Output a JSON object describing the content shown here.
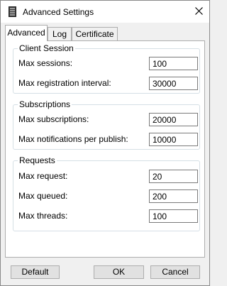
{
  "window": {
    "title": "Advanced Settings"
  },
  "tabs": [
    {
      "label": "Advanced",
      "active": true
    },
    {
      "label": "Log",
      "active": false
    },
    {
      "label": "Certificate",
      "active": false
    }
  ],
  "groups": {
    "client_session": {
      "title": "Client Session",
      "max_sessions": {
        "label": "Max sessions:",
        "value": "100"
      },
      "max_registration_interval": {
        "label": "Max registration interval:",
        "value": "30000"
      }
    },
    "subscriptions": {
      "title": "Subscriptions",
      "max_subscriptions": {
        "label": "Max subscriptions:",
        "value": "20000"
      },
      "max_notifications_per_publish": {
        "label": "Max notifications per publish:",
        "value": "10000"
      }
    },
    "requests": {
      "title": "Requests",
      "max_request": {
        "label": "Max request:",
        "value": "20"
      },
      "max_queued": {
        "label": "Max queued:",
        "value": "200"
      },
      "max_threads": {
        "label": "Max threads:",
        "value": "100"
      }
    }
  },
  "buttons": {
    "default": "Default",
    "ok": "OK",
    "cancel": "Cancel"
  }
}
